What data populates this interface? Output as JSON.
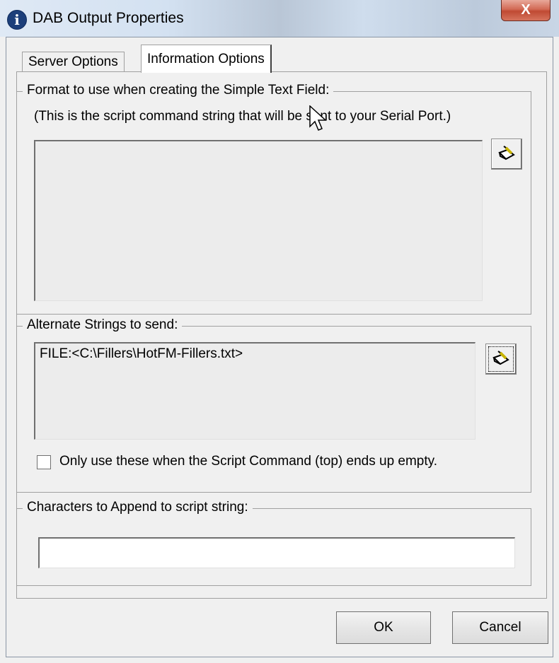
{
  "window": {
    "title": "DAB Output Properties",
    "close_glyph": "X",
    "title_icon": "info-icon"
  },
  "tabs": [
    {
      "label": "Server Options",
      "selected": false
    },
    {
      "label": "Information Options",
      "selected": true
    }
  ],
  "simple_text_field": {
    "group_label": "Format to use when creating the Simple Text Field:",
    "hint": "(This is the script command string that will be sent to your Serial Port.)",
    "value": "",
    "edit_icon": "edit-pencil-icon"
  },
  "alternate_strings": {
    "group_label": "Alternate Strings to send:",
    "value": "FILE:<C:\\Fillers\\HotFM-Fillers.txt>",
    "edit_icon": "edit-pencil-icon",
    "checkbox_label": "Only use these when the Script Command (top) ends up empty.",
    "checkbox_checked": false
  },
  "append_chars": {
    "group_label": "Characters to Append to script string:",
    "value": ""
  },
  "buttons": {
    "ok": "OK",
    "cancel": "Cancel"
  },
  "colors": {
    "dialog_bg": "#f0f0f0",
    "close_button": "#c04a33",
    "title_icon": "#1d3f7a"
  }
}
